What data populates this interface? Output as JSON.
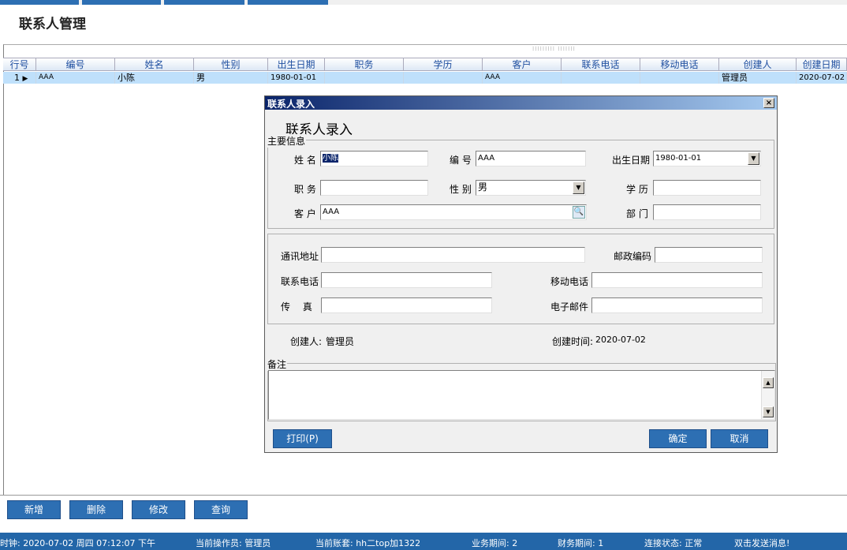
{
  "page_title": "联系人管理",
  "grid": {
    "columns": [
      "行号",
      "编号",
      "姓名",
      "性别",
      "出生日期",
      "职务",
      "学历",
      "客户",
      "联系电话",
      "移动电话",
      "创建人",
      "创建日期"
    ],
    "rows": [
      {
        "row_no": "1",
        "code": "AAA",
        "name": "小陈",
        "gender": "男",
        "birth": "1980-01-01",
        "title": "",
        "education": "",
        "customer": "AAA",
        "phone": "",
        "mobile": "",
        "creator": "管理员",
        "created": "2020-07-02"
      }
    ]
  },
  "dialog": {
    "window_title": "联系人录入",
    "close_glyph": "×",
    "heading": "联系人录入",
    "main_group": "主要信息",
    "labels": {
      "name": "姓 名",
      "code": "编 号",
      "birth": "出生日期",
      "title": "职 务",
      "gender": "性 别",
      "education": "学 历",
      "customer": "客 户",
      "dept": "部 门",
      "address": "通讯地址",
      "zip": "邮政编码",
      "phone": "联系电话",
      "mobile": "移动电话",
      "fax": "传　 真",
      "email": "电子邮件",
      "creator": "创建人:",
      "created_time": "创建时间:",
      "memo": "备注"
    },
    "values": {
      "name": "小陈",
      "code": "AAA",
      "birth": "1980-01-01",
      "title": "",
      "gender": "男",
      "education": "",
      "customer": "AAA",
      "dept": "",
      "address": "",
      "zip": "",
      "phone": "",
      "mobile": "",
      "fax": "",
      "email": "",
      "creator": "管理员",
      "created_time": "2020-07-02",
      "memo": ""
    },
    "buttons": {
      "print": "打印(P)",
      "ok": "确定",
      "cancel": "取消"
    }
  },
  "bottom_buttons": {
    "add": "新增",
    "delete": "删除",
    "edit": "修改",
    "query": "查询"
  },
  "status": {
    "clock": "时钟: 2020-07-02 周四 07:12:07 下午",
    "operator": "当前操作员: 管理员",
    "account": "当前账套: hh二top加1322",
    "biz_period": "业务期间: 2",
    "fin_period": "财务期间: 1",
    "conn": "连接状态: 正常",
    "message": "双击发送消息!"
  },
  "colors": {
    "accent": "#2d6fb3",
    "status_bar": "#2366a8",
    "selected_row": "#bfe0fb",
    "header_text": "#1f4fa0"
  }
}
